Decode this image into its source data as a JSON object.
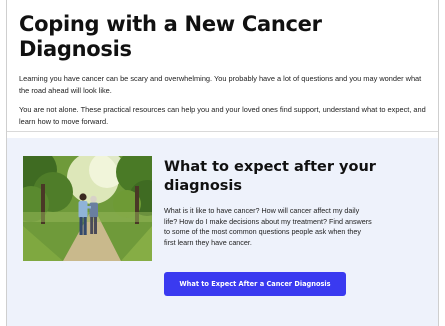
{
  "page": {
    "title": "Coping with a New Cancer Diagnosis",
    "intro_1": "Learning you have cancer can be scary and overwhelming. You probably have a lot of questions and you may wonder what the road ahead will look like.",
    "intro_2": "You are not alone. These practical resources can help you and your loved ones find support, understand what to expect, and learn how to move forward."
  },
  "card": {
    "image_icon": "photo-couple-walking",
    "title": "What to expect after your diagnosis",
    "body": "What is it like to have cancer? How will cancer affect my daily life? How do I make decisions about my treatment? Find answers to some of the most common questions people ask when they first learn they have cancer.",
    "button_label": "What to Expect After a Cancer Diagnosis",
    "button_color": "#3a3af0",
    "background_color": "#eef2fb"
  }
}
